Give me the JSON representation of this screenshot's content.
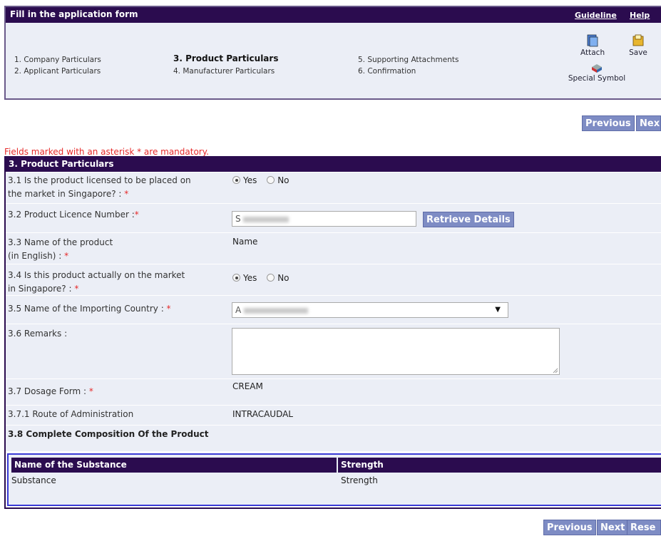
{
  "header": {
    "title": "Fill in the application form",
    "links": [
      "Guideline",
      "Help"
    ],
    "steps": [
      {
        "label": "1. Company Particulars",
        "current": false
      },
      {
        "label": "2. Applicant Particulars",
        "current": false
      },
      {
        "label": "3. Product Particulars",
        "current": true
      },
      {
        "label": "4. Manufacturer Particulars",
        "current": false
      },
      {
        "label": "5. Supporting Attachments",
        "current": false
      },
      {
        "label": "6. Confirmation",
        "current": false
      }
    ],
    "tools": {
      "attach": "Attach",
      "save": "Save",
      "special": "Special Symbol"
    }
  },
  "nav_top": {
    "previous": "Previous",
    "next": "Nex"
  },
  "mandatory_note": "Fields marked with an asterisk * are mandatory.",
  "section": {
    "title": "3. Product Particulars",
    "q1": {
      "label_a": "3.1 Is the product licensed to be placed on",
      "label_b": "the market in Singapore? : ",
      "yes": "Yes",
      "no": "No",
      "selected": "Yes"
    },
    "q2": {
      "label": "3.2 Product Licence Number :",
      "value_prefix": "S",
      "retrieve": "Retrieve Details"
    },
    "q3": {
      "label_a": "3.3 Name of the product",
      "label_b": "(in English) : ",
      "value": "Name"
    },
    "q4": {
      "label_a": "3.4 Is this product actually on the market",
      "label_b": "in Singapore? : ",
      "yes": "Yes",
      "no": "No",
      "selected": "Yes"
    },
    "q5": {
      "label": "3.5 Name of the Importing Country : ",
      "value_prefix": "A"
    },
    "q6": {
      "label": "3.6 Remarks :"
    },
    "q7": {
      "label": "3.7 Dosage Form : ",
      "value": "CREAM"
    },
    "q71": {
      "label": "3.7.1 Route of Administration",
      "value": "INTRACAUDAL"
    },
    "q8": {
      "label": "3.8 Complete Composition Of the Product"
    },
    "composition": {
      "columns": [
        "Name of the Substance",
        "Strength"
      ],
      "rows": [
        [
          "Substance",
          "Strength"
        ]
      ]
    }
  },
  "nav_bottom": {
    "previous": "Previous",
    "next": "Next",
    "reset": "Rese"
  },
  "asterisk": "*",
  "colors": {
    "header_bg": "#2b0c4f",
    "panel_bg": "#ebeef6",
    "button": "#7e8cc4",
    "mandatory": "#e62a2a"
  }
}
